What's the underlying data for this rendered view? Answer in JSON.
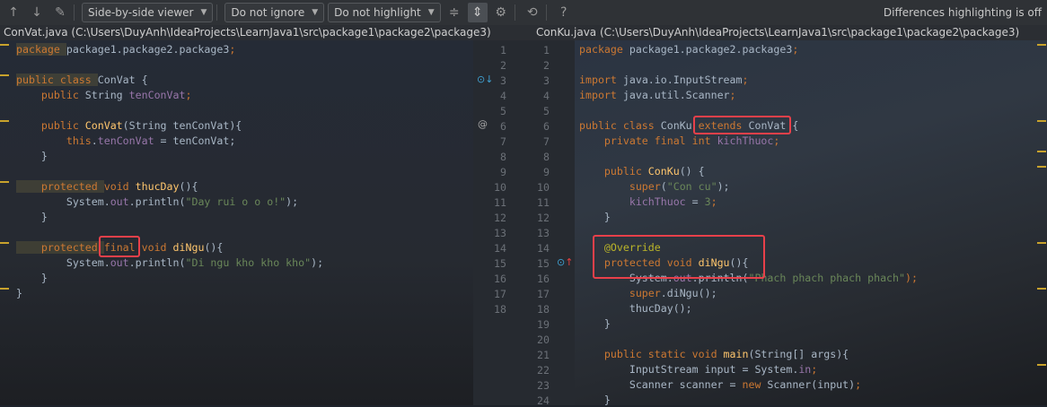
{
  "toolbar": {
    "viewer": "Side-by-side viewer",
    "ignore": "Do not ignore",
    "highlight": "Do not highlight",
    "status": "Differences highlighting is off",
    "icons": [
      "arrow-up-icon",
      "arrow-down-icon",
      "edit-icon",
      "collapse-icon",
      "sync-scroll-icon",
      "gear-icon",
      "diff-settings-icon",
      "help-icon"
    ]
  },
  "left": {
    "header": "ConVat.java (C:\\Users\\DuyAnh\\IdeaProjects\\LearnJava1\\src\\package1\\package2\\package3)",
    "lines": [
      [
        [
          "package ",
          "kw hl"
        ],
        [
          "package1.package2.package3",
          ""
        ],
        [
          ";",
          "kw"
        ]
      ],
      [],
      [
        [
          "public class ",
          "kw hl"
        ],
        [
          "ConVat {",
          "pl"
        ]
      ],
      [
        [
          "    public ",
          "kw"
        ],
        [
          "String ",
          "pl"
        ],
        [
          "tenConVat",
          "fld"
        ],
        [
          ";",
          "kw"
        ]
      ],
      [],
      [
        [
          "    public ",
          "kw"
        ],
        [
          "ConVat",
          "fn"
        ],
        [
          "(String tenConVat){",
          "pl"
        ]
      ],
      [
        [
          "        this",
          "kw"
        ],
        [
          ".",
          "pl"
        ],
        [
          "tenConVat",
          "fld"
        ],
        [
          " = tenConVat;",
          "pl"
        ]
      ],
      [
        [
          "    }",
          "pl"
        ]
      ],
      [],
      [
        [
          "    protected ",
          "kw hl"
        ],
        [
          "void ",
          "kw"
        ],
        [
          "thucDay",
          "fn"
        ],
        [
          "(){",
          "pl"
        ]
      ],
      [
        [
          "        System.",
          "pl"
        ],
        [
          "out",
          "fld"
        ],
        [
          ".println(",
          "pl"
        ],
        [
          "\"Day rui o o o!\"",
          "str"
        ],
        [
          ");",
          "pl"
        ]
      ],
      [
        [
          "    }",
          "pl"
        ]
      ],
      [],
      [
        [
          "    protected ",
          "kw hl"
        ],
        [
          "final",
          "kw"
        ],
        [
          " void ",
          "kw"
        ],
        [
          "diNgu",
          "fn"
        ],
        [
          "(){",
          "pl"
        ]
      ],
      [
        [
          "        System.",
          "pl"
        ],
        [
          "out",
          "fld"
        ],
        [
          ".println(",
          "pl"
        ],
        [
          "\"Di ngu kho kho kho\"",
          "str"
        ],
        [
          ");",
          "pl"
        ]
      ],
      [
        [
          "    }",
          "pl"
        ]
      ],
      [
        [
          "}",
          "pl"
        ]
      ],
      []
    ]
  },
  "right": {
    "header": "ConKu.java (C:\\Users\\DuyAnh\\IdeaProjects\\LearnJava1\\src\\package1\\package2\\package3)",
    "lines": [
      [
        [
          "package ",
          "kw"
        ],
        [
          "package1.package2.package3",
          ""
        ],
        [
          ";",
          "kw"
        ]
      ],
      [],
      [
        [
          "import ",
          "kw"
        ],
        [
          "java.io.InputStream",
          "pl"
        ],
        [
          ";",
          "kw"
        ]
      ],
      [
        [
          "import ",
          "kw"
        ],
        [
          "java.util.Scanner",
          "pl"
        ],
        [
          ";",
          "kw"
        ]
      ],
      [],
      [
        [
          "public class ",
          "kw"
        ],
        [
          "ConKu ",
          "pl"
        ],
        [
          "extends ",
          "kw"
        ],
        [
          "ConVat {",
          "pl"
        ]
      ],
      [
        [
          "    private final int ",
          "kw"
        ],
        [
          "kichThuoc",
          "fld"
        ],
        [
          ";",
          "kw"
        ]
      ],
      [],
      [
        [
          "    public ",
          "kw"
        ],
        [
          "ConKu",
          "fn"
        ],
        [
          "() {",
          "pl"
        ]
      ],
      [
        [
          "        super",
          "kw"
        ],
        [
          "(",
          "pl"
        ],
        [
          "\"Con cu\"",
          "str"
        ],
        [
          ");",
          "pl"
        ]
      ],
      [
        [
          "        kichThuoc",
          "fld"
        ],
        [
          " = ",
          "pl"
        ],
        [
          "3",
          "str"
        ],
        [
          ";",
          "kw"
        ]
      ],
      [
        [
          "    }",
          "pl"
        ]
      ],
      [],
      [
        [
          "    @Override",
          "ann"
        ]
      ],
      [
        [
          "    protected void ",
          "kw"
        ],
        [
          "diNgu",
          "fn"
        ],
        [
          "(){",
          "pl"
        ]
      ],
      [
        [
          "        System.",
          "pl"
        ],
        [
          "out",
          "fld"
        ],
        [
          ".println(",
          "pl"
        ],
        [
          "\"Phach phach phach phach\"",
          "str"
        ],
        [
          ");",
          "kw"
        ]
      ],
      [
        [
          "        super",
          "kw"
        ],
        [
          ".diNgu();",
          "pl"
        ]
      ],
      [
        [
          "        thucDay();",
          "pl"
        ]
      ],
      [
        [
          "    }",
          "pl"
        ]
      ],
      [],
      [
        [
          "    public static void ",
          "kw"
        ],
        [
          "main",
          "fn"
        ],
        [
          "(String[] args){",
          "pl"
        ]
      ],
      [
        [
          "        InputStream input = System.",
          "pl"
        ],
        [
          "in",
          "fld"
        ],
        [
          ";",
          "kw"
        ]
      ],
      [
        [
          "        Scanner scanner = ",
          "pl"
        ],
        [
          "new ",
          "kw"
        ],
        [
          "Scanner(input)",
          "pl"
        ],
        [
          ";",
          "kw"
        ]
      ],
      [
        [
          "    }",
          "pl"
        ]
      ]
    ]
  }
}
